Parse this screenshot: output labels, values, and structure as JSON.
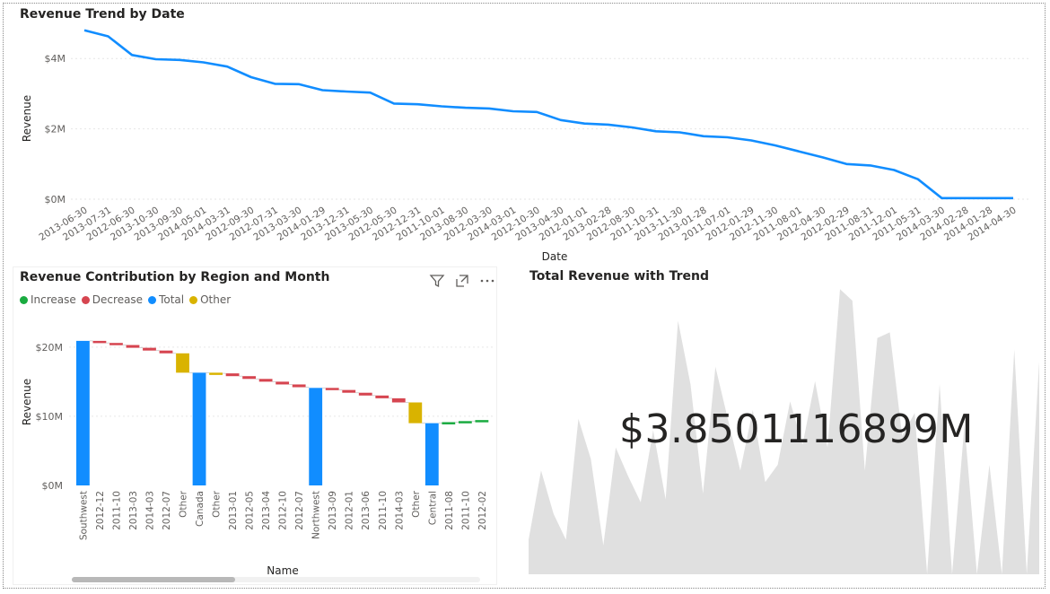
{
  "line_chart": {
    "title": "Revenue Trend by Date",
    "xlabel": "Date",
    "ylabel": "Revenue"
  },
  "waterfall": {
    "title": "Revenue Contribution by Region and Month",
    "xlabel": "Name",
    "ylabel": "Revenue",
    "legend": [
      {
        "label": "Increase",
        "color": "#1aab40"
      },
      {
        "label": "Decrease",
        "color": "#d64550"
      },
      {
        "label": "Total",
        "color": "#118dff"
      },
      {
        "label": "Other",
        "color": "#d9b300"
      }
    ]
  },
  "kpi": {
    "title": "Total Revenue with Trend",
    "value": "$3.8501116899M"
  },
  "chart_data": [
    {
      "type": "line",
      "title": "Revenue Trend by Date",
      "xlabel": "Date",
      "ylabel": "Revenue",
      "color": "#118dff",
      "ylim": [
        0,
        5
      ],
      "y_ticks": [
        "$0M",
        "$2M",
        "$4M"
      ],
      "y_tick_values": [
        0,
        2,
        4
      ],
      "x": [
        "2013-06-30",
        "2013-07-31",
        "2012-06-30",
        "2013-10-30",
        "2013-09-30",
        "2014-05-01",
        "2014-03-31",
        "2012-09-30",
        "2012-07-31",
        "2013-03-30",
        "2014-01-29",
        "2013-12-31",
        "2013-05-30",
        "2012-05-30",
        "2012-12-31",
        "2011-10-01",
        "2013-08-30",
        "2012-03-30",
        "2014-03-01",
        "2012-10-30",
        "2013-04-30",
        "2012-01-01",
        "2013-02-28",
        "2012-08-30",
        "2011-10-31",
        "2013-11-30",
        "2013-01-28",
        "2011-07-01",
        "2012-01-29",
        "2012-11-30",
        "2011-08-01",
        "2012-04-30",
        "2012-02-29",
        "2011-08-31",
        "2011-12-01",
        "2011-05-31",
        "2014-03-30",
        "2014-02-28",
        "2014-01-28",
        "2014-04-30"
      ],
      "y": [
        4.8,
        4.63,
        4.1,
        3.98,
        3.96,
        3.89,
        3.77,
        3.47,
        3.28,
        3.27,
        3.1,
        3.06,
        3.03,
        2.72,
        2.7,
        2.64,
        2.6,
        2.58,
        2.5,
        2.48,
        2.25,
        2.15,
        2.12,
        2.04,
        1.93,
        1.9,
        1.79,
        1.76,
        1.67,
        1.53,
        1.36,
        1.19,
        1.0,
        0.96,
        0.83,
        0.57,
        0.03,
        0.03,
        0.03,
        0.03
      ]
    },
    {
      "type": "bar",
      "subtype": "waterfall",
      "title": "Revenue Contribution by Region and Month",
      "xlabel": "Name",
      "ylabel": "Revenue",
      "ylim": [
        0,
        24
      ],
      "y_ticks": [
        "$0M",
        "$10M",
        "$20M"
      ],
      "y_tick_values": [
        0,
        10,
        20
      ],
      "legend_position": "top-left",
      "categories": [
        "Southwest",
        "2012-12",
        "2011-10",
        "2013-03",
        "2014-03",
        "2012-07",
        "Other",
        "Canada",
        "Other",
        "2013-01",
        "2012-05",
        "2013-04",
        "2012-10",
        "2012-07",
        "Northwest",
        "2013-09",
        "2012-01",
        "2013-06",
        "2011-10",
        "2014-03",
        "Other",
        "Central",
        "2011-08",
        "2011-10",
        "2012-02"
      ],
      "kinds": [
        "total",
        "decrease",
        "decrease",
        "decrease",
        "decrease",
        "decrease",
        "other",
        "total",
        "other",
        "decrease",
        "decrease",
        "decrease",
        "decrease",
        "decrease",
        "total",
        "decrease",
        "decrease",
        "decrease",
        "decrease",
        "decrease",
        "other",
        "total",
        "increase",
        "increase",
        "increase"
      ],
      "starts": [
        0,
        20.9,
        20.6,
        20.3,
        19.9,
        19.5,
        19.1,
        0,
        16.3,
        16.2,
        15.8,
        15.4,
        15.0,
        14.6,
        0,
        14.1,
        13.8,
        13.4,
        13.0,
        12.6,
        12.0,
        0,
        9.0,
        9.15,
        9.3
      ],
      "ends": [
        20.9,
        20.6,
        20.3,
        19.9,
        19.5,
        19.1,
        16.3,
        16.3,
        16.2,
        15.8,
        15.4,
        15.0,
        14.6,
        14.2,
        14.1,
        13.8,
        13.4,
        13.0,
        12.6,
        12.0,
        9.0,
        9.0,
        9.15,
        9.3,
        9.45
      ]
    },
    {
      "type": "area",
      "title": "Total Revenue with Trend",
      "color": "#e0e0e0",
      "ylim": [
        0,
        1
      ],
      "values": [
        0.12,
        0.36,
        0.21,
        0.12,
        0.54,
        0.4,
        0.1,
        0.44,
        0.34,
        0.25,
        0.5,
        0.26,
        0.88,
        0.66,
        0.28,
        0.72,
        0.54,
        0.36,
        0.57,
        0.32,
        0.38,
        0.6,
        0.45,
        0.67,
        0.44,
        0.99,
        0.95,
        0.36,
        0.82,
        0.84,
        0.48,
        0.56,
        0.0,
        0.66,
        0.0,
        0.52,
        0.0,
        0.38,
        0.0,
        0.78,
        0.0,
        0.74
      ]
    }
  ]
}
